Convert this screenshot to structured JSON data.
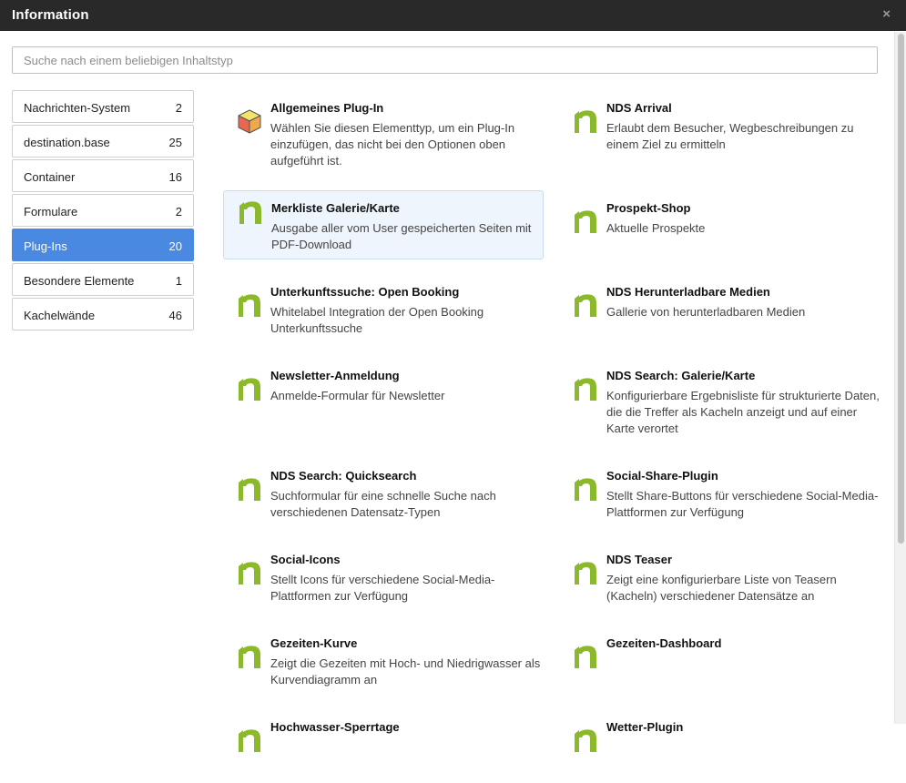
{
  "window": {
    "title": "Information",
    "close_label": "×"
  },
  "search": {
    "placeholder": "Suche nach einem beliebigen Inhaltstyp"
  },
  "sidebar": {
    "items": [
      {
        "label": "Nachrichten-System",
        "count": "2"
      },
      {
        "label": "destination.base",
        "count": "25"
      },
      {
        "label": "Container",
        "count": "16"
      },
      {
        "label": "Formulare",
        "count": "2"
      },
      {
        "label": "Plug-Ins",
        "count": "20",
        "active": true
      },
      {
        "label": "Besondere Elemente",
        "count": "1"
      },
      {
        "label": "Kachelwände",
        "count": "46"
      }
    ]
  },
  "items": [
    {
      "title": "Allgemeines Plug-In",
      "desc": "Wählen Sie diesen Elementtyp, um ein Plug-In einzufügen, das nicht bei den Optionen oben aufgeführt ist.",
      "icon": "cube-icon"
    },
    {
      "title": "NDS Arrival",
      "desc": "Erlaubt dem Besucher, Wegbeschreibungen zu einem Ziel zu ermitteln",
      "icon": "nds-logo-icon"
    },
    {
      "title": "Merkliste Galerie/Karte",
      "desc": "Ausgabe aller vom User gespeicherten Seiten mit PDF-Download",
      "icon": "nds-logo-icon",
      "selected": true
    },
    {
      "title": "Prospekt-Shop",
      "desc": "Aktuelle Prospekte",
      "icon": "nds-logo-icon"
    },
    {
      "title": "Unterkunftssuche: Open Booking",
      "desc": "Whitelabel Integration der Open Booking Unterkunftssuche",
      "icon": "nds-logo-icon"
    },
    {
      "title": "NDS Herunterladbare Medien",
      "desc": "Gallerie von herunterladbaren Medien",
      "icon": "nds-logo-icon"
    },
    {
      "title": "Newsletter-Anmeldung",
      "desc": "Anmelde-Formular für Newsletter",
      "icon": "nds-logo-icon"
    },
    {
      "title": "NDS Search: Galerie/Karte",
      "desc": "Konfigurierbare Ergebnisliste für strukturierte Daten, die die Treffer als Kacheln anzeigt und auf einer Karte verortet",
      "icon": "nds-logo-icon"
    },
    {
      "title": "NDS Search: Quicksearch",
      "desc": "Suchformular für eine schnelle Suche nach verschiedenen Datensatz-Typen",
      "icon": "nds-logo-icon"
    },
    {
      "title": "Social-Share-Plugin",
      "desc": "Stellt Share-Buttons für verschiedene Social-Media-Plattformen zur Verfügung",
      "icon": "nds-logo-icon"
    },
    {
      "title": "Social-Icons",
      "desc": "Stellt Icons für verschiedene Social-Media-Plattformen zur Verfügung",
      "icon": "nds-logo-icon"
    },
    {
      "title": "NDS Teaser",
      "desc": "Zeigt eine konfigurierbare Liste von Teasern (Kacheln) verschiedener Datensätze an",
      "icon": "nds-logo-icon"
    },
    {
      "title": "Gezeiten-Kurve",
      "desc": "Zeigt die Gezeiten mit Hoch- und Niedrigwasser als Kurvendiagramm an",
      "icon": "nds-logo-icon"
    },
    {
      "title": "Gezeiten-Dashboard",
      "desc": "",
      "icon": "nds-logo-icon"
    },
    {
      "title": "Hochwasser-Sperrtage",
      "desc": "",
      "icon": "nds-logo-icon"
    },
    {
      "title": "Wetter-Plugin",
      "desc": "",
      "icon": "nds-logo-icon"
    }
  ],
  "colors": {
    "accent": "#4a89e2",
    "logo_green": "#8cb82b",
    "titlebar": "#292929"
  }
}
